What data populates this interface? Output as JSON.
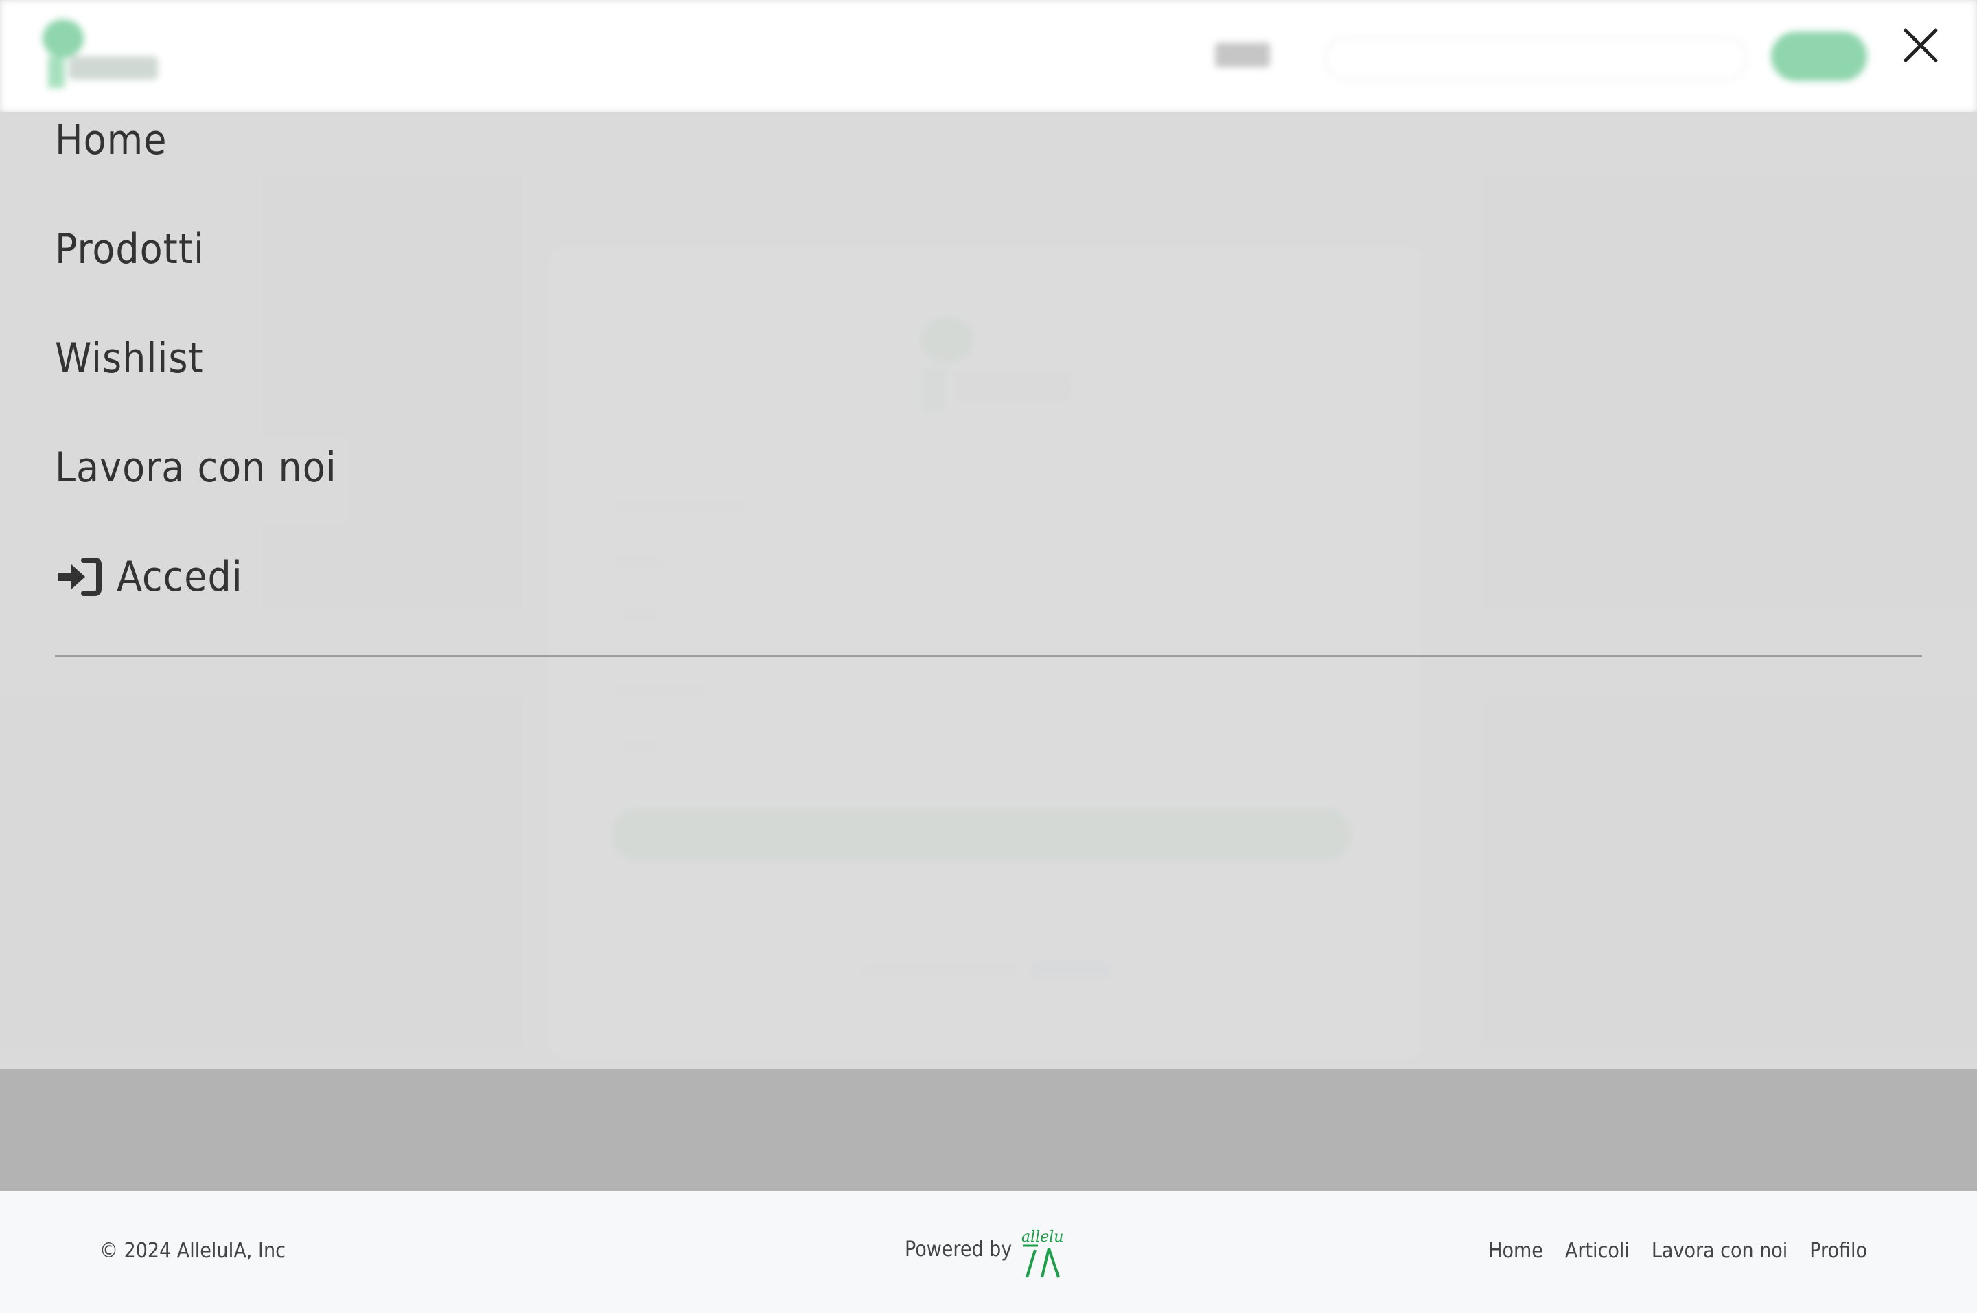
{
  "menu": {
    "items": [
      {
        "label": "Home"
      },
      {
        "label": "Prodotti"
      },
      {
        "label": "Wishlist"
      },
      {
        "label": "Lavora con noi"
      },
      {
        "label": "Accedi",
        "icon": "login-icon"
      }
    ],
    "close_icon": "close-icon"
  },
  "footer": {
    "copyright": "© 2024 AlleluIA, Inc",
    "powered_by": "Powered by",
    "brand_logo_text": "alleluIA",
    "nav": [
      {
        "label": "Home"
      },
      {
        "label": "Articoli"
      },
      {
        "label": "Lavora con noi"
      },
      {
        "label": "Profilo"
      }
    ]
  },
  "colors": {
    "accent_green": "#8fd5ad",
    "brand_green": "#1e9e4a",
    "overlay": "#d9d9d9",
    "text": "#333333"
  }
}
